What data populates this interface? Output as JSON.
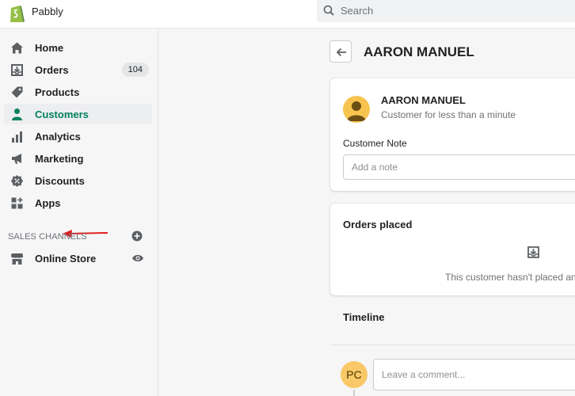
{
  "topbar": {
    "store_name": "Pabbly",
    "search_placeholder": "Search"
  },
  "sidebar": {
    "items": [
      {
        "label": "Home",
        "icon": "home-icon"
      },
      {
        "label": "Orders",
        "icon": "orders-icon",
        "badge": "104"
      },
      {
        "label": "Products",
        "icon": "tag-icon"
      },
      {
        "label": "Customers",
        "icon": "person-icon",
        "active": true
      },
      {
        "label": "Analytics",
        "icon": "bar-chart-icon"
      },
      {
        "label": "Marketing",
        "icon": "megaphone-icon"
      },
      {
        "label": "Discounts",
        "icon": "discount-icon"
      },
      {
        "label": "Apps",
        "icon": "apps-icon"
      }
    ],
    "section_label": "SALES CHANNELS",
    "channels": [
      {
        "label": "Online Store",
        "icon": "store-icon"
      }
    ]
  },
  "page": {
    "title": "AARON MANUEL"
  },
  "customer_card": {
    "name": "AARON MANUEL",
    "subtitle": "Customer for less than a minute",
    "note_label": "Customer Note",
    "note_placeholder": "Add a note"
  },
  "orders_card": {
    "title": "Orders placed",
    "empty_text": "This customer hasn't placed any"
  },
  "timeline": {
    "title": "Timeline",
    "avatar_initials": "PC",
    "comment_placeholder": "Leave a comment..."
  },
  "colors": {
    "accent": "#008060",
    "annotation_arrow": "#e02020",
    "avatar": "#f7c450"
  }
}
